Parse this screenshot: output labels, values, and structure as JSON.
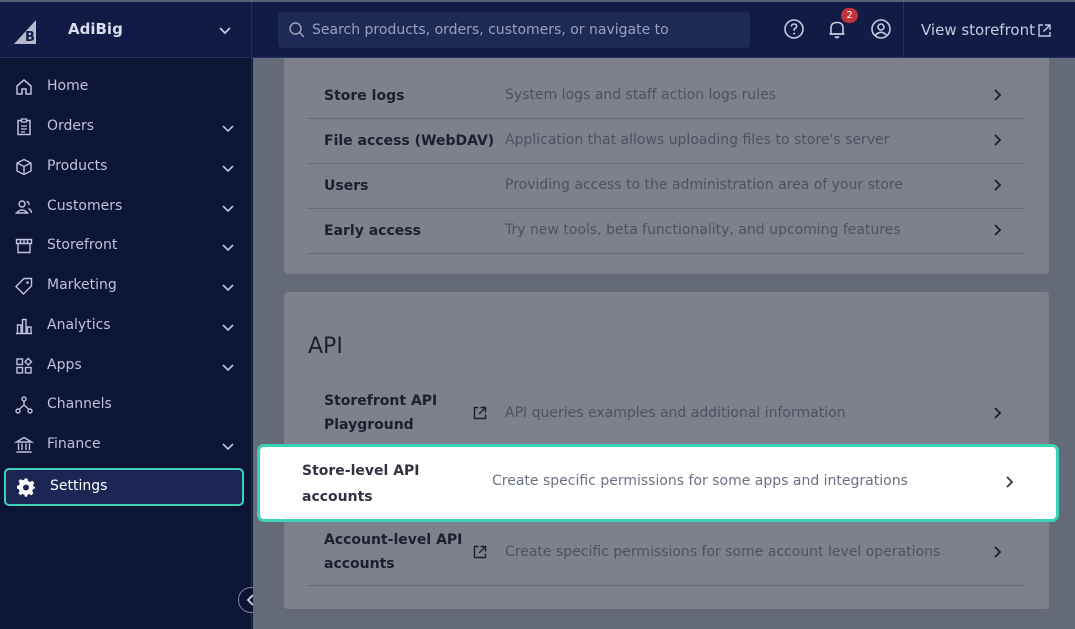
{
  "brand": {
    "name": "AdiBig"
  },
  "search": {
    "placeholder": "Search products, orders, customers, or navigate to"
  },
  "header": {
    "notifications_count": "2",
    "view_storefront": "View storefront"
  },
  "sidebar": {
    "items": [
      {
        "label": "Home",
        "icon": "home-icon"
      },
      {
        "label": "Orders",
        "icon": "orders-icon"
      },
      {
        "label": "Products",
        "icon": "products-icon"
      },
      {
        "label": "Customers",
        "icon": "customers-icon"
      },
      {
        "label": "Storefront",
        "icon": "storefront-icon"
      },
      {
        "label": "Marketing",
        "icon": "tag-icon"
      },
      {
        "label": "Analytics",
        "icon": "analytics-icon"
      },
      {
        "label": "Apps",
        "icon": "apps-icon"
      },
      {
        "label": "Channels",
        "icon": "channels-icon"
      },
      {
        "label": "Finance",
        "icon": "finance-icon"
      },
      {
        "label": "Settings",
        "icon": "gear-icon"
      }
    ]
  },
  "settings_rows": [
    {
      "title": "Store logs",
      "description": "System logs and staff action logs rules"
    },
    {
      "title": "File access (WebDAV)",
      "description": "Application that allows uploading files to store's server"
    },
    {
      "title": "Users",
      "description": "Providing access to the administration area of your store"
    },
    {
      "title": "Early access",
      "description": "Try new tools, beta functionality, and upcoming features"
    }
  ],
  "api": {
    "title": "API",
    "rows": [
      {
        "title_line1": "Storefront API",
        "title_line2": "Playground",
        "description": "API queries examples and additional information"
      },
      {
        "title_line1": "Store-level API",
        "title_line2": "accounts",
        "description": "Create specific permissions for some apps and integrations"
      },
      {
        "title_line1": "Account-level API",
        "title_line2": "accounts",
        "description": "Create specific permissions for some account level operations"
      }
    ]
  },
  "colors": {
    "accent": "#3ad2b9",
    "sidebar_bg": "#0d1537",
    "badge": "#c2323b"
  }
}
